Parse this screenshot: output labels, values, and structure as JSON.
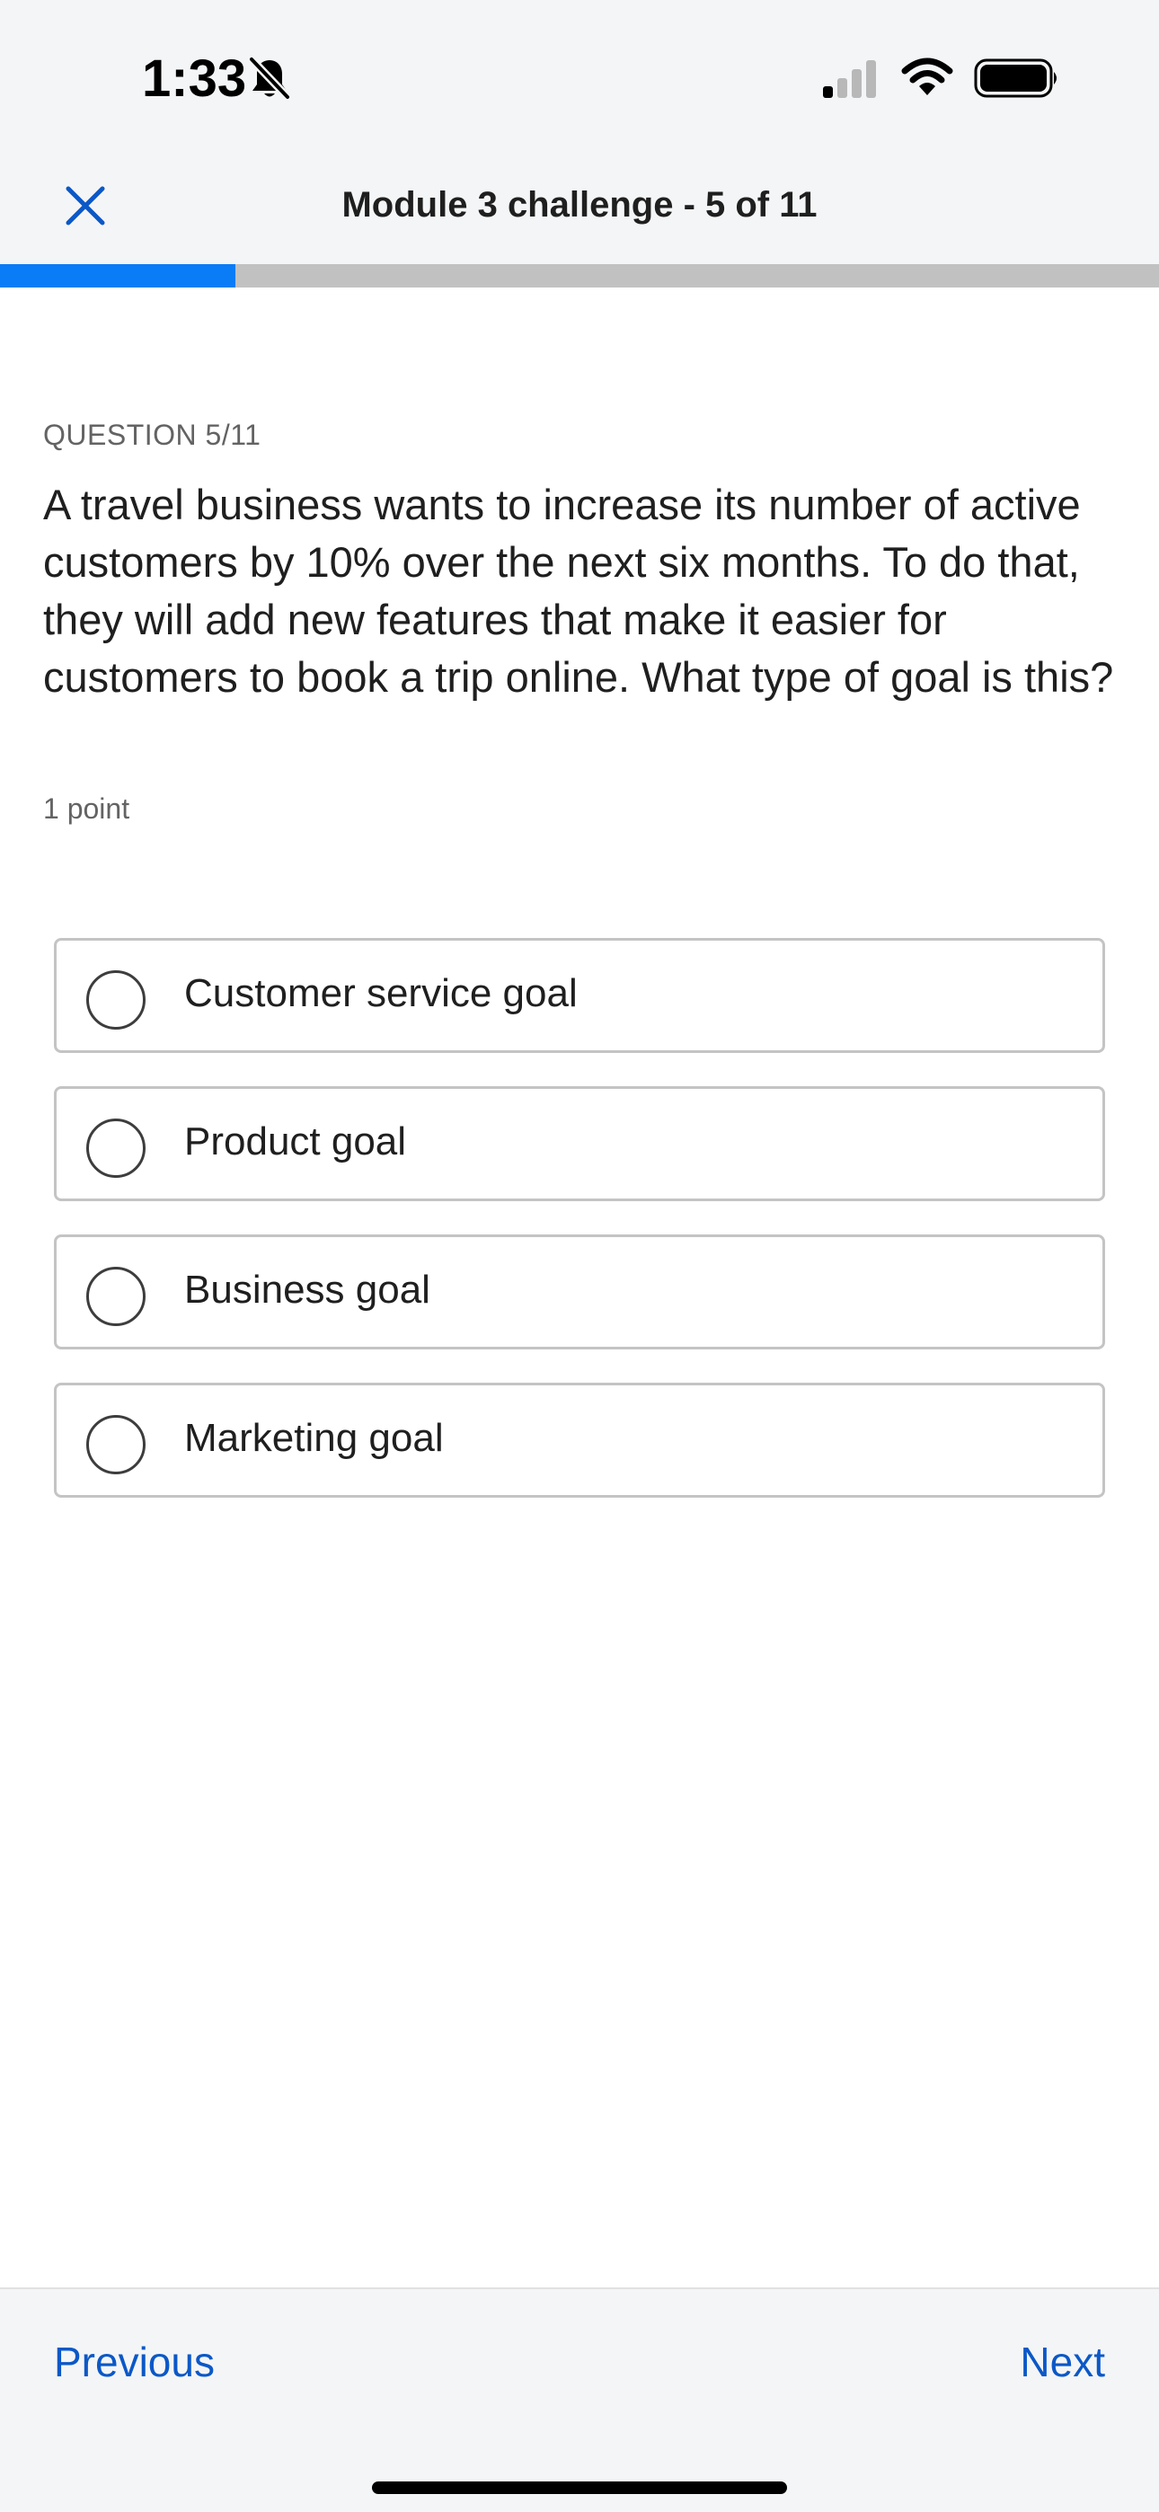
{
  "status_bar": {
    "time": "1:33",
    "icons": [
      "bell-off-icon",
      "signal-icon",
      "wifi-icon",
      "battery-icon"
    ]
  },
  "header": {
    "title": "Module 3 challenge - 5 of 11",
    "close_icon": "close-icon"
  },
  "progress": {
    "current": 5,
    "total": 11,
    "fraction": 0.2033,
    "fill_color": "#0a7cf5",
    "track_color": "#c1c1c1"
  },
  "question": {
    "label": "QUESTION 5/11",
    "text": "A travel business wants to increase its number of active customers by 10% over the next six months. To do that, they will add new features that make it easier for customers to book a trip online. What type of goal is this?",
    "points": "1 point"
  },
  "options": [
    {
      "label": "Customer service goal",
      "selected": false
    },
    {
      "label": "Product goal",
      "selected": false
    },
    {
      "label": "Business goal",
      "selected": false
    },
    {
      "label": "Marketing goal",
      "selected": false
    }
  ],
  "footer": {
    "previous_label": "Previous",
    "next_label": "Next",
    "link_color": "#0b58c7"
  }
}
